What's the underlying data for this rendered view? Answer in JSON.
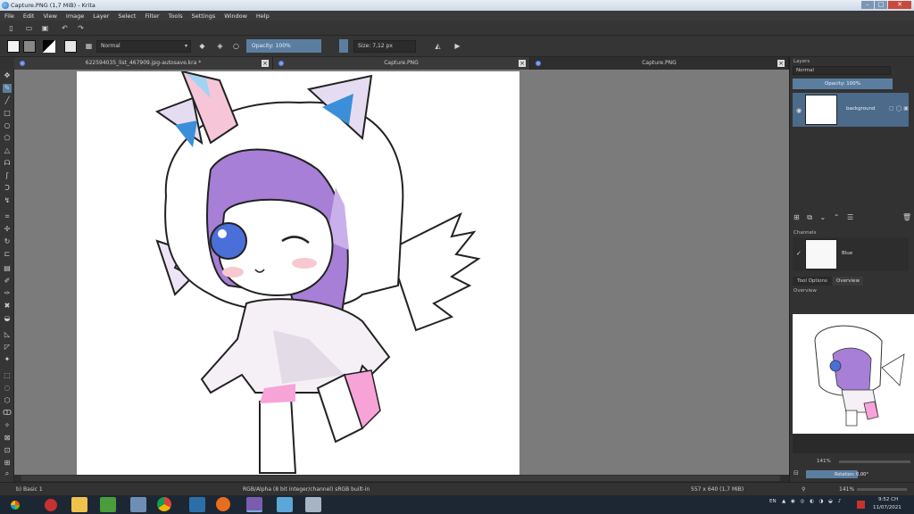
{
  "window": {
    "title": "Capture.PNG (1,7 MiB) - Krita",
    "buttons": [
      "–",
      "□",
      "✕"
    ]
  },
  "menu": [
    "File",
    "Edit",
    "View",
    "Image",
    "Layer",
    "Select",
    "Filter",
    "Tools",
    "Settings",
    "Window",
    "Help"
  ],
  "tool_options_bar": {
    "blend_mode": "Normal",
    "opacity": "Opacity: 100%",
    "size": "Size: 7,12 px"
  },
  "tabs": [
    {
      "label": "622594035_list_467909.jpg-autosave.kra *",
      "active": false
    },
    {
      "label": "Capture.PNG",
      "active": false
    },
    {
      "label": "Capture.PNG",
      "active": true
    }
  ],
  "layers_panel": {
    "title": "Layers",
    "blend_mode": "Normal",
    "opacity": "Opacity: 100%",
    "layer_name": "background"
  },
  "channels_panel": {
    "title": "Channels",
    "channel_name": "Blue"
  },
  "docker_tabs": [
    "Tool Options",
    "Overview"
  ],
  "overview_panel": {
    "title": "Overview",
    "zoom": "141%",
    "rotation": "Rotation: 0,00°"
  },
  "status": {
    "brush": "b) Basic 1",
    "color_info": "RGB/Alpha (8 bit integer/channel) sRGB built-in",
    "image_size": "557 x 640 (1,7 MiB)",
    "zoom": "141%"
  },
  "taskbar": {
    "lang": "EN",
    "time": "9:52 CH",
    "date": "11/07/2021"
  },
  "colors": {
    "accent": "#5b7ea0",
    "panel": "#323232",
    "canvas_bg": "#7b7b7b"
  }
}
